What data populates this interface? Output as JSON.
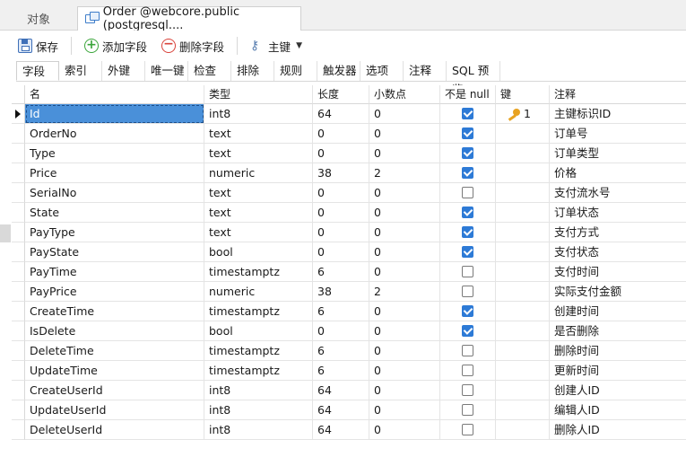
{
  "top_tabs": [
    {
      "label": "对象"
    },
    {
      "label": "Order @webcore.public (postgresql...."
    }
  ],
  "toolbar": {
    "save": "保存",
    "add_field": "添加字段",
    "delete_field": "删除字段",
    "primary_key": "主键"
  },
  "subtabs": [
    "字段",
    "索引",
    "外键",
    "唯一键",
    "检查",
    "排除",
    "规则",
    "触发器",
    "选项",
    "注释",
    "SQL 预览"
  ],
  "columns": {
    "name": "名",
    "type": "类型",
    "length": "长度",
    "decimals": "小数点",
    "not_null": "不是 null",
    "key": "键",
    "comment": "注释"
  },
  "rows": [
    {
      "name": "Id",
      "type": "int8",
      "length": "64",
      "decimals": "0",
      "not_null": true,
      "key": "1",
      "comment": "主键标识ID"
    },
    {
      "name": "OrderNo",
      "type": "text",
      "length": "0",
      "decimals": "0",
      "not_null": true,
      "key": "",
      "comment": "订单号"
    },
    {
      "name": "Type",
      "type": "text",
      "length": "0",
      "decimals": "0",
      "not_null": true,
      "key": "",
      "comment": "订单类型"
    },
    {
      "name": "Price",
      "type": "numeric",
      "length": "38",
      "decimals": "2",
      "not_null": true,
      "key": "",
      "comment": "价格"
    },
    {
      "name": "SerialNo",
      "type": "text",
      "length": "0",
      "decimals": "0",
      "not_null": false,
      "key": "",
      "comment": "支付流水号"
    },
    {
      "name": "State",
      "type": "text",
      "length": "0",
      "decimals": "0",
      "not_null": true,
      "key": "",
      "comment": "订单状态"
    },
    {
      "name": "PayType",
      "type": "text",
      "length": "0",
      "decimals": "0",
      "not_null": true,
      "key": "",
      "comment": "支付方式"
    },
    {
      "name": "PayState",
      "type": "bool",
      "length": "0",
      "decimals": "0",
      "not_null": true,
      "key": "",
      "comment": "支付状态"
    },
    {
      "name": "PayTime",
      "type": "timestamptz",
      "length": "6",
      "decimals": "0",
      "not_null": false,
      "key": "",
      "comment": "支付时间"
    },
    {
      "name": "PayPrice",
      "type": "numeric",
      "length": "38",
      "decimals": "2",
      "not_null": false,
      "key": "",
      "comment": "实际支付金额"
    },
    {
      "name": "CreateTime",
      "type": "timestamptz",
      "length": "6",
      "decimals": "0",
      "not_null": true,
      "key": "",
      "comment": "创建时间"
    },
    {
      "name": "IsDelete",
      "type": "bool",
      "length": "0",
      "decimals": "0",
      "not_null": true,
      "key": "",
      "comment": "是否删除"
    },
    {
      "name": "DeleteTime",
      "type": "timestamptz",
      "length": "6",
      "decimals": "0",
      "not_null": false,
      "key": "",
      "comment": "删除时间"
    },
    {
      "name": "UpdateTime",
      "type": "timestamptz",
      "length": "6",
      "decimals": "0",
      "not_null": false,
      "key": "",
      "comment": "更新时间"
    },
    {
      "name": "CreateUserId",
      "type": "int8",
      "length": "64",
      "decimals": "0",
      "not_null": false,
      "key": "",
      "comment": "创建人ID"
    },
    {
      "name": "UpdateUserId",
      "type": "int8",
      "length": "64",
      "decimals": "0",
      "not_null": false,
      "key": "",
      "comment": "编辑人ID"
    },
    {
      "name": "DeleteUserId",
      "type": "int8",
      "length": "64",
      "decimals": "0",
      "not_null": false,
      "key": "",
      "comment": "删除人ID"
    }
  ],
  "icons": {
    "save": "save-icon",
    "add": "plus-circle-icon",
    "delete": "minus-circle-icon",
    "primary_key": "key-icon",
    "table_tab": "table-icon"
  },
  "colors": {
    "accent": "#2d7ad6",
    "selection": "#4a90d9",
    "add": "#3aa53a",
    "delete": "#d9423a",
    "key": "#e8a322"
  }
}
